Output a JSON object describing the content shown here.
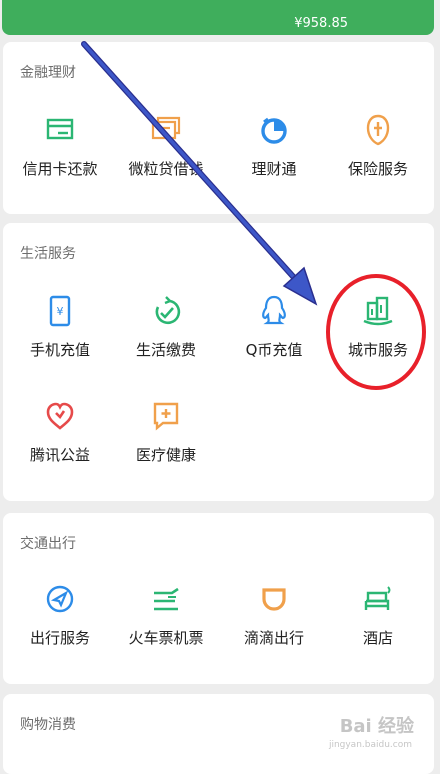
{
  "header": {
    "amount": "¥958.85"
  },
  "sections": [
    {
      "title": "金融理财",
      "items": [
        {
          "label": "信用卡还款",
          "icon": "credit-card-icon",
          "color": "#2bb673"
        },
        {
          "label": "微粒贷借钱",
          "icon": "loan-icon",
          "color": "#f0a04b"
        },
        {
          "label": "理财通",
          "icon": "wealth-icon",
          "color": "#2d8ce8"
        },
        {
          "label": "保险服务",
          "icon": "insurance-icon",
          "color": "#f0a04b"
        }
      ]
    },
    {
      "title": "生活服务",
      "items": [
        {
          "label": "手机充值",
          "icon": "phone-recharge-icon",
          "color": "#2d8ce8"
        },
        {
          "label": "生活缴费",
          "icon": "bill-payment-icon",
          "color": "#2bb673"
        },
        {
          "label": "Q币充值",
          "icon": "qq-coin-icon",
          "color": "#2d8ce8"
        },
        {
          "label": "城市服务",
          "icon": "city-service-icon",
          "color": "#2bb673"
        },
        {
          "label": "腾讯公益",
          "icon": "charity-icon",
          "color": "#e64a4a"
        },
        {
          "label": "医疗健康",
          "icon": "medical-icon",
          "color": "#f0a04b"
        }
      ]
    },
    {
      "title": "交通出行",
      "items": [
        {
          "label": "出行服务",
          "icon": "travel-icon",
          "color": "#2d8ce8"
        },
        {
          "label": "火车票机票",
          "icon": "train-ticket-icon",
          "color": "#2bb673"
        },
        {
          "label": "滴滴出行",
          "icon": "didi-icon",
          "color": "#f0a04b"
        },
        {
          "label": "酒店",
          "icon": "hotel-icon",
          "color": "#2bb673"
        }
      ]
    },
    {
      "title": "购物消费",
      "items": []
    }
  ],
  "annotation": {
    "arrow_color": "#3d57c8",
    "circle_color": "#e8202a"
  },
  "watermark": {
    "text": "Bai 经验",
    "sub": "jingyan.baidu.com"
  }
}
